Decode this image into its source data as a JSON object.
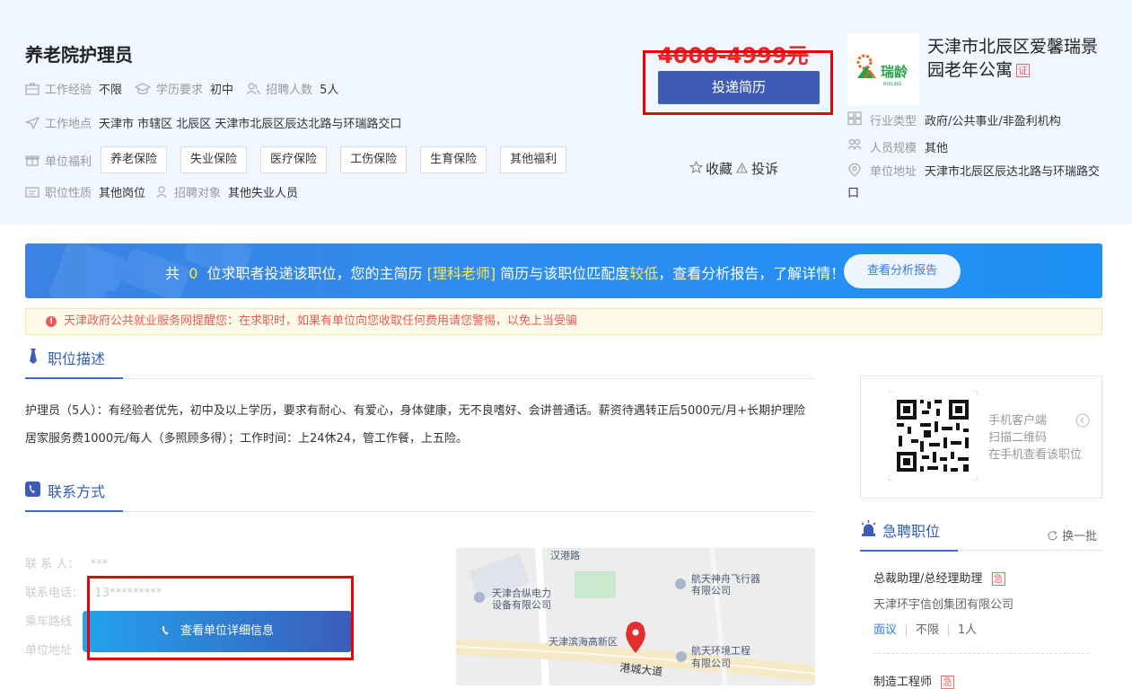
{
  "job": {
    "title": "养老院护理员",
    "experience_label": "工作经验",
    "experience_value": "不限",
    "education_label": "学历要求",
    "education_value": "初中",
    "headcount_label": "招聘人数",
    "headcount_value": "5人",
    "location_label": "工作地点",
    "location_value": "天津市 市辖区 北辰区 天津市北辰区辰达北路与环瑞路交口",
    "welfare_label": "单位福利",
    "welfare_tags": [
      "养老保险",
      "失业保险",
      "医疗保险",
      "工伤保险",
      "生育保险",
      "其他福利"
    ],
    "nature_label": "职位性质",
    "nature_value": "其他岗位",
    "target_label": "招聘对象",
    "target_value": "其他失业人员",
    "salary": "4000-4999元",
    "apply_label": "投递简历",
    "favorite_label": "收藏",
    "report_label": "投诉"
  },
  "company": {
    "name": "天津市北辰区爱馨瑞景园老年公寓",
    "cert_badge": "证",
    "logo_text": "瑞龄",
    "logo_sub": "RUILING",
    "industry_label": "行业类型",
    "industry_value": "政府/公共事业/非盈利机构",
    "scale_label": "人员规模",
    "scale_value": "其他",
    "address_label": "单位地址",
    "address_value": "天津市北辰区辰达北路与环瑞路交口"
  },
  "banner": {
    "prefix": "共",
    "count": "0",
    "mid": "位求职者投递该职位，您的主简历",
    "resume": "[理科老师]",
    "mid2": "简历与该职位匹配度",
    "level": "较低",
    "suffix": "，查看分析报告，了解详情！",
    "button": "查看分析报告"
  },
  "notice": "天津政府公共就业服务网提醒您：在求职时，如果有单位向您收取任何费用请您警惕，以免上当受骗",
  "description": {
    "title": "职位描述",
    "text": "护理员（5人）：有经验者优先，初中及以上学历，要求有耐心、有爱心，身体健康，无不良嗜好、会讲普通话。薪资待遇转正后5000元/月+长期护理险居家服务费1000元/每人（多照顾多得）；工作时间：上24休24，管工作餐，上五险。"
  },
  "contact": {
    "title": "联系方式",
    "person_label": "联 系 人：",
    "person_value": "***",
    "phone_label": "联系电话：",
    "phone_value": "13*********",
    "route_label": "乘车路线",
    "address_label": "单位地址",
    "detail_button": "查看单位详细信息"
  },
  "map": {
    "road_top": "汉港路",
    "poi1": "天津合纵电力设备有限公司",
    "poi1_line1": "天津合纵电力",
    "poi1_line2": "设备有限公司",
    "poi2_line1": "航天神舟飞行器",
    "poi2_line2": "有限公司",
    "poi3": "天津滨海高新区",
    "poi4_line1": "航天环境工程",
    "poi4_line2": "有限公司",
    "road_bottom": "港城大道"
  },
  "qr": {
    "line1": "手机客户端",
    "line2": "扫描二维码",
    "line3": "在手机查看该职位"
  },
  "urgent": {
    "title": "急聘职位",
    "swap": "换一批",
    "jobs": [
      {
        "title": "总裁助理/总经理助理",
        "badge": "急",
        "company": "天津环宇信创集团有限公司",
        "salary": "面议",
        "exp": "不限",
        "count": "1人"
      },
      {
        "title": "制造工程师",
        "badge": "急"
      }
    ]
  }
}
